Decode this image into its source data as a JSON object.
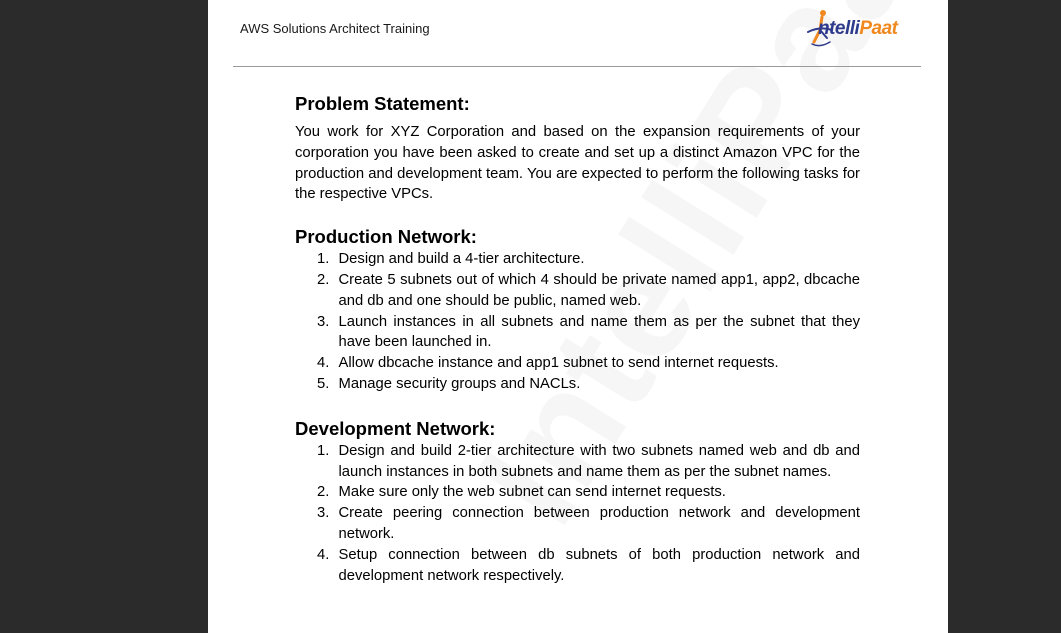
{
  "header": {
    "title": "AWS Solutions Architect Training",
    "logo_text_part1": "ntelli",
    "logo_text_part2": "Paat",
    "watermark": "IntelliPaat"
  },
  "problem": {
    "heading": "Problem Statement:",
    "body": "You work for XYZ Corporation and based on the expansion requirements of your corporation you have been asked to create and set up a distinct Amazon VPC for the production and development team. You are expected to perform the following tasks for the respective VPCs."
  },
  "production": {
    "heading": "Production Network:",
    "items": [
      {
        "num": "1.",
        "text": "Design and build a 4-tier architecture."
      },
      {
        "num": "2.",
        "text": "Create 5 subnets out of which 4 should be private named app1, app2, dbcache and db and one should be public, named web."
      },
      {
        "num": "3.",
        "text": "Launch instances in all subnets and name them as per the subnet that they have been launched in."
      },
      {
        "num": "4.",
        "text": "Allow dbcache instance and app1 subnet to send internet requests."
      },
      {
        "num": "5.",
        "text": "Manage security groups and NACLs."
      }
    ]
  },
  "development": {
    "heading": "Development Network:",
    "items": [
      {
        "num": "1.",
        "text": "Design and build 2-tier architecture with two subnets named web and db and launch instances in both subnets and name them as per the subnet names."
      },
      {
        "num": "2.",
        "text": "Make sure only the web subnet can send internet requests."
      },
      {
        "num": "3.",
        "text": "Create peering connection between production network and development network."
      },
      {
        "num": "4.",
        "text": "Setup connection between db subnets of both production network and development network respectively."
      }
    ]
  },
  "colors": {
    "logo_blue": "#2e3a8c",
    "logo_orange": "#f0891f",
    "background": "#2b2b2b"
  }
}
